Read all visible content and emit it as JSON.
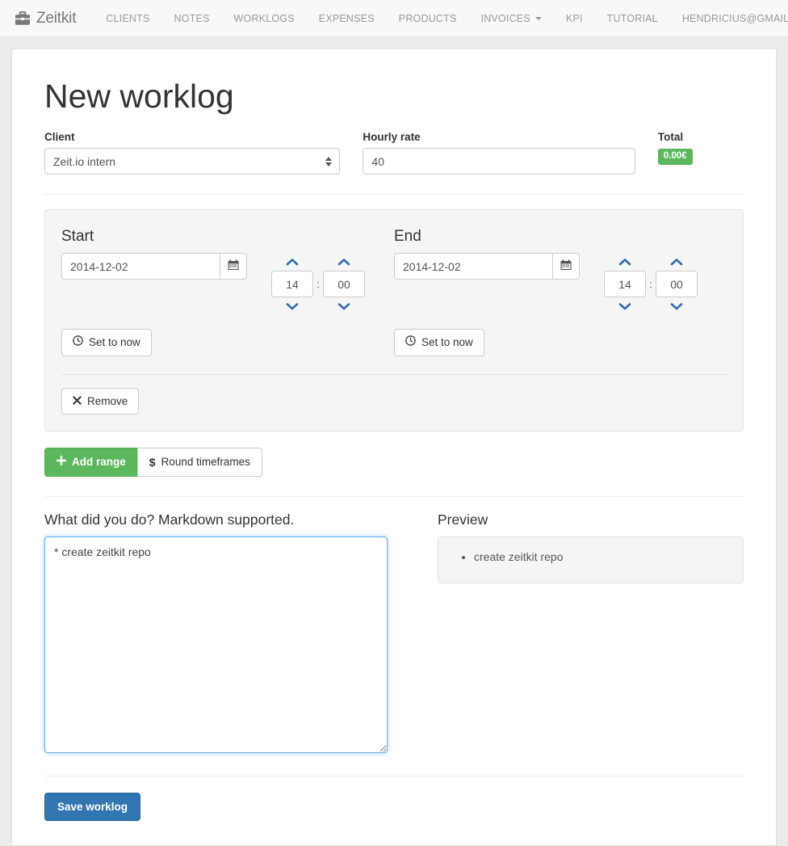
{
  "navbar": {
    "brand": "Zeitkit",
    "brand_icon": "briefcase-icon",
    "links": [
      {
        "label": "CLIENTS",
        "name": "nav-clients",
        "caret": false
      },
      {
        "label": "NOTES",
        "name": "nav-notes",
        "caret": false
      },
      {
        "label": "WORKLOGS",
        "name": "nav-worklogs",
        "caret": false
      },
      {
        "label": "EXPENSES",
        "name": "nav-expenses",
        "caret": false
      },
      {
        "label": "PRODUCTS",
        "name": "nav-products",
        "caret": false
      },
      {
        "label": "INVOICES",
        "name": "nav-invoices",
        "caret": true
      },
      {
        "label": "KPI",
        "name": "nav-kpi",
        "caret": false
      },
      {
        "label": "TUTORIAL",
        "name": "nav-tutorial",
        "caret": false
      }
    ],
    "account": {
      "label": "HENDRICIUS@GMAIL.COM",
      "caret": true
    }
  },
  "page": {
    "title": "New worklog"
  },
  "form": {
    "client_label": "Client",
    "client_value": "Zeit.io intern",
    "client_options": [
      "Zeit.io intern"
    ],
    "hourly_rate_label": "Hourly rate",
    "hourly_rate_value": "40",
    "total_label": "Total",
    "total_value": "0.00€",
    "total_color": "#5cb85c"
  },
  "ranges": [
    {
      "start": {
        "title": "Start",
        "date": "2014-12-02",
        "hours": "14",
        "minutes": "00",
        "separator": ":",
        "set_now_label": "Set to now",
        "set_now_icon": "clock-icon",
        "calendar_icon": "calendar-icon"
      },
      "end": {
        "title": "End",
        "date": "2014-12-02",
        "hours": "14",
        "minutes": "00",
        "separator": ":",
        "set_now_label": "Set to now",
        "set_now_icon": "clock-icon",
        "calendar_icon": "calendar-icon"
      },
      "remove_label": "Remove",
      "remove_icon": "x-icon"
    }
  ],
  "actions": {
    "add_range_label": "Add range",
    "add_range_icon": "plus-icon",
    "add_range_color": "#5cb85c",
    "round_label": "Round timeframes",
    "round_icon": "dollar-icon"
  },
  "markdown": {
    "editor_label": "What did you do? Markdown supported.",
    "editor_value_prefix": "* create ",
    "editor_value_misspelled": "zeitkit",
    "editor_value_suffix": " repo",
    "editor_value": "* create zeitkit repo",
    "preview_label": "Preview",
    "preview_items": [
      "create zeitkit repo"
    ]
  },
  "footer": {
    "save_label": "Save worklog",
    "save_color": "#3276b1"
  }
}
